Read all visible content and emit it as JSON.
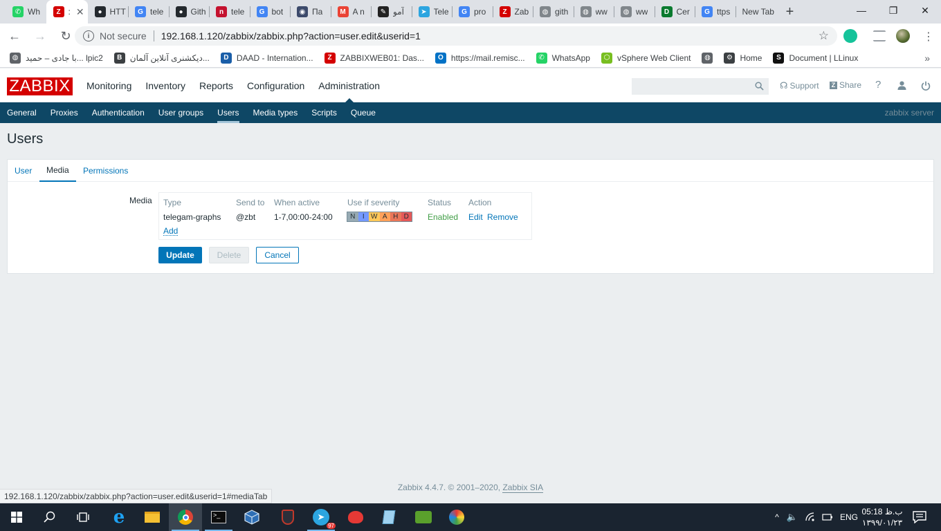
{
  "browser": {
    "tabs": [
      {
        "title": "Wh",
        "fav_color": "#25d366",
        "fav_glyph": "✆",
        "icon": "whatsapp-icon"
      },
      {
        "title": ":",
        "fav_color": "#d40000",
        "fav_glyph": "Z",
        "icon": "zabbix-icon",
        "active": true
      },
      {
        "title": "HTT",
        "fav_color": "#24292e",
        "fav_glyph": "●",
        "icon": "github-icon"
      },
      {
        "title": "tele",
        "fav_color": "#4285f4",
        "fav_glyph": "G",
        "icon": "google-icon"
      },
      {
        "title": "Gith",
        "fav_color": "#24292e",
        "fav_glyph": "●",
        "icon": "github-icon"
      },
      {
        "title": "tele",
        "fav_color": "#c4122f",
        "fav_glyph": "n",
        "icon": "news-icon"
      },
      {
        "title": "bot",
        "fav_color": "#4285f4",
        "fav_glyph": "G",
        "icon": "google-icon"
      },
      {
        "title": "Па",
        "fav_color": "#3c4a6b",
        "fav_glyph": "◉",
        "icon": "app-icon"
      },
      {
        "title": "A n",
        "fav_color": "#ea4335",
        "fav_glyph": "M",
        "icon": "gmail-icon"
      },
      {
        "title": "آمو",
        "fav_color": "#222222",
        "fav_glyph": "✎",
        "icon": "pen-icon"
      },
      {
        "title": "Tele",
        "fav_color": "#2ca5e0",
        "fav_glyph": "➤",
        "icon": "telegram-icon"
      },
      {
        "title": "pro",
        "fav_color": "#4285f4",
        "fav_glyph": "G",
        "icon": "google-icon"
      },
      {
        "title": "Zab",
        "fav_color": "#d40000",
        "fav_glyph": "Z",
        "icon": "zabbix-icon"
      },
      {
        "title": "gith",
        "fav_color": "#80868b",
        "fav_glyph": "◍",
        "icon": "globe-icon"
      },
      {
        "title": "ww",
        "fav_color": "#80868b",
        "fav_glyph": "◍",
        "icon": "globe-icon"
      },
      {
        "title": "ww",
        "fav_color": "#80868b",
        "fav_glyph": "◍",
        "icon": "globe-icon"
      },
      {
        "title": "Cer",
        "fav_color": "#0a7a2f",
        "fav_glyph": "D",
        "icon": "certificate-icon"
      },
      {
        "title": "ttps",
        "fav_color": "#4285f4",
        "fav_glyph": "G",
        "icon": "google-icon"
      },
      {
        "title": "New Tab",
        "fav_color": "",
        "fav_glyph": "",
        "icon": "",
        "newtab": true
      }
    ],
    "new_tab_glyph": "+",
    "window_controls": {
      "minimize": "—",
      "restore": "❐",
      "close": "✕"
    },
    "nav": {
      "back": "←",
      "forward": "→",
      "reload": "↻"
    },
    "omnibox": {
      "info_glyph": "i",
      "security": "Not secure",
      "url": "192.168.1.120/zabbix/zabbix.php?action=user.edit&userid=1",
      "star_glyph": "☆"
    },
    "bookmarks": [
      {
        "label": "با جادی – حمید... lpic2",
        "fav_color": "#5f6368",
        "fav_glyph": "◍",
        "icon": "globe-icon"
      },
      {
        "label": "دیکشنری آنلاین آلمان...",
        "fav_color": "#3c4043",
        "fav_glyph": "B",
        "icon": "dictionary-icon"
      },
      {
        "label": "DAAD - Internation...",
        "fav_color": "#1a5ea8",
        "fav_glyph": "D",
        "icon": "daad-icon"
      },
      {
        "label": "ZABBIXWEB01: Das...",
        "fav_color": "#d40000",
        "fav_glyph": "Z",
        "icon": "zabbix-icon"
      },
      {
        "label": "https://mail.remisc...",
        "fav_color": "#0072c6",
        "fav_glyph": "O",
        "icon": "outlook-icon"
      },
      {
        "label": "WhatsApp",
        "fav_color": "#25d366",
        "fav_glyph": "✆",
        "icon": "whatsapp-icon"
      },
      {
        "label": "vSphere Web Client",
        "fav_color": "#78be20",
        "fav_glyph": "⬡",
        "icon": "vsphere-icon"
      },
      {
        "label": "",
        "fav_color": "#5f6368",
        "fav_glyph": "◍",
        "icon": "globe-icon"
      },
      {
        "label": "Home",
        "fav_color": "#3c4043",
        "fav_glyph": "⚙",
        "icon": "gear-icon"
      },
      {
        "label": "Document | LLinux",
        "fav_color": "#111111",
        "fav_glyph": "S",
        "icon": "document-icon"
      }
    ],
    "bookmarks_more": "»",
    "status_url": "192.168.1.120/zabbix/zabbix.php?action=user.edit&userid=1#mediaTab"
  },
  "zabbix": {
    "logo": "ZABBIX",
    "top_menu": [
      "Monitoring",
      "Inventory",
      "Reports",
      "Configuration",
      "Administration"
    ],
    "top_menu_selected": 4,
    "header_links": {
      "support": "Support",
      "share": "Share",
      "help": "?"
    },
    "sub_menu": [
      "General",
      "Proxies",
      "Authentication",
      "User groups",
      "Users",
      "Media types",
      "Scripts",
      "Queue"
    ],
    "sub_menu_selected": 4,
    "server_name": "zabbix server",
    "page_title": "Users",
    "tabs": [
      "User",
      "Media",
      "Permissions"
    ],
    "tabs_selected": 1,
    "form_label": "Media",
    "media_table": {
      "headers": [
        "Type",
        "Send to",
        "When active",
        "Use if severity",
        "Status",
        "Action"
      ],
      "rows": [
        {
          "type": "telegam-graphs",
          "send_to": "@zbt",
          "when_active": "1-7,00:00-24:00",
          "status": "Enabled",
          "edit": "Edit",
          "remove": "Remove"
        }
      ],
      "severity_letters": [
        "N",
        "I",
        "W",
        "A",
        "H",
        "D"
      ],
      "severity_colors": [
        "#97aab3",
        "#7499ff",
        "#ffc859",
        "#ffa059",
        "#e97659",
        "#e45959"
      ],
      "add": "Add"
    },
    "buttons": {
      "update": "Update",
      "delete": "Delete",
      "cancel": "Cancel"
    },
    "footer": {
      "text": "Zabbix 4.4.7. © 2001–2020, ",
      "link": "Zabbix SIA"
    }
  },
  "taskbar": {
    "tray": {
      "chevron": "^",
      "lang": "ENG"
    },
    "clock": {
      "time": "05:18 ب.ظ",
      "date": "۱۳۹۹/۰۱/۲۳"
    },
    "telegram_badge": "97"
  }
}
